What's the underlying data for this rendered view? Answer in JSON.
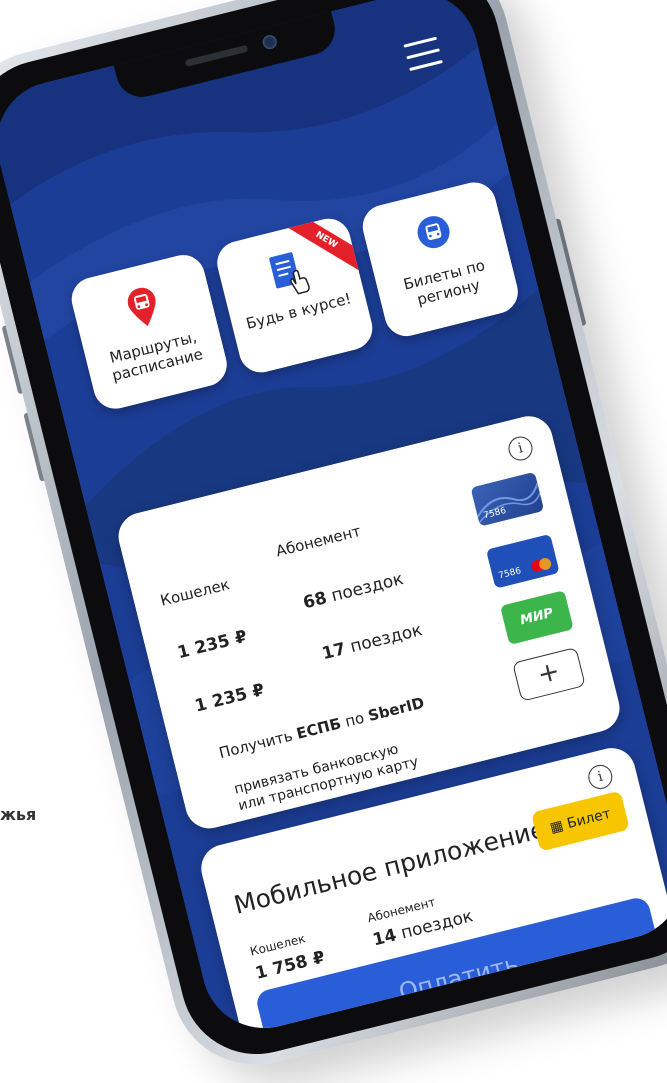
{
  "background_text": "жья",
  "menu": {
    "icon": "hamburger-icon"
  },
  "tiles": [
    {
      "label": "Маршруты, расписание",
      "icon": "bus-pin-icon",
      "icon_color": "#e4202a"
    },
    {
      "label": "Будь в курсе!",
      "icon": "document-tap-icon",
      "icon_color": "#2a5ed8",
      "badge": "NEW",
      "badge_color": "#e4202a"
    },
    {
      "label": "Билеты по региону",
      "icon": "bus-circle-icon",
      "icon_color": "#2a5ed8"
    }
  ],
  "card": {
    "info_icon": "i",
    "col_wallet": "Кошелек",
    "col_pass": "Абонемент",
    "rows": [
      {
        "wallet": "1 235 ₽",
        "trips_num": "68",
        "trips_word": "поездок",
        "card_label": "7586",
        "card_color": "#2a4a9a"
      },
      {
        "wallet": "1 235 ₽",
        "trips_num": "17",
        "trips_word": "поездок",
        "card_label": "7586",
        "card_color": "#1f4fb8"
      }
    ],
    "mir_label": "МИР",
    "mir_color": "#3cb54a",
    "espb_pre": "Получить ",
    "espb_bold": "ЕСПБ",
    "espb_mid": " по ",
    "espb_sber": "SberID",
    "add_symbol": "+",
    "bind_line1": "привязать банковскую",
    "bind_line2": "или транспортную карту"
  },
  "mobile": {
    "info_icon": "i",
    "title": "Мобильное приложение",
    "ticket_label": "Билет",
    "ticket_color": "#f7c600",
    "col_wallet": "Кошелек",
    "col_pass": "Абонемент",
    "wallet": "1 758 ₽",
    "trips_num": "14",
    "trips_word": "поездок",
    "pay_label": "Оплатить",
    "pay_color": "#2a5ed8"
  }
}
